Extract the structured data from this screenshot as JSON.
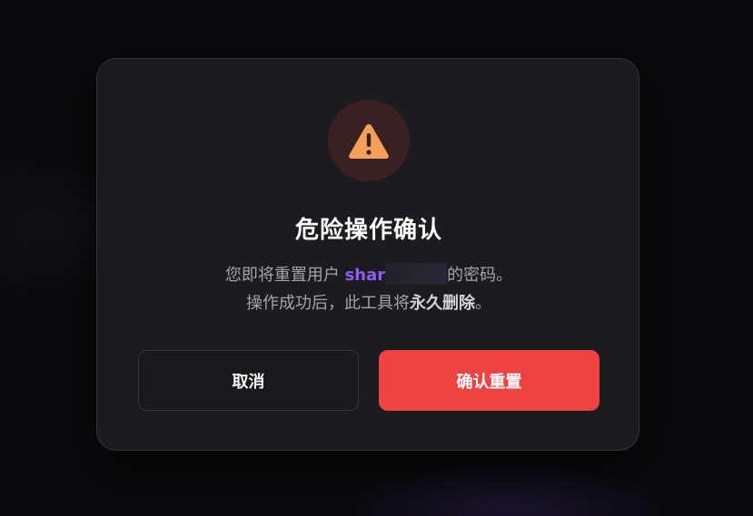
{
  "dialog": {
    "icon": "warning-icon",
    "title": "危险操作确认",
    "message_line1_prefix": "您即将重置用户",
    "username_visible": "shar",
    "message_line1_suffix": "的密码。",
    "message_line2_prefix": "操作成功后，此工具将",
    "message_line2_emphasis": "永久删除",
    "message_line2_suffix": "。",
    "cancel_label": "取消",
    "confirm_label": "确认重置"
  },
  "colors": {
    "dialog_bg": "#1c1c1f",
    "accent_danger": "#ef4444",
    "username": "#8b5cf6",
    "warning_icon": "#f5a05a",
    "icon_circle_bg": "#3a2020"
  }
}
